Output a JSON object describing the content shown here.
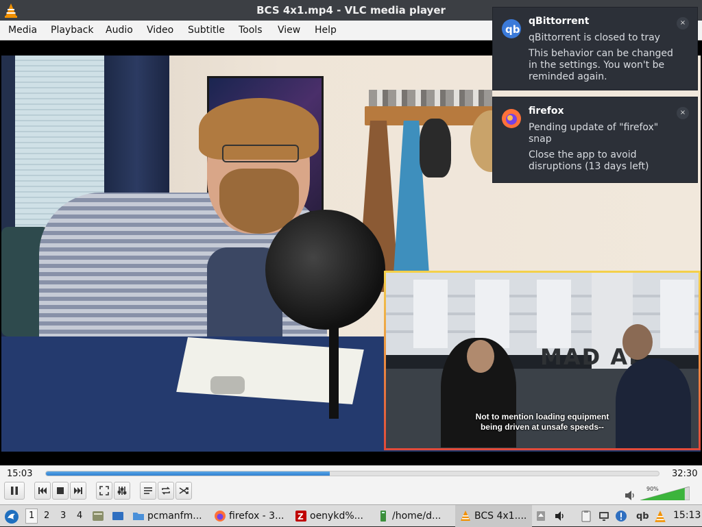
{
  "window": {
    "title": "BCS 4x1.mp4 - VLC media player"
  },
  "menu": [
    "Media",
    "Playback",
    "Audio",
    "Video",
    "Subtitle",
    "Tools",
    "View",
    "Help"
  ],
  "video": {
    "subtitle_line1": "Not to mention loading equipment",
    "subtitle_line2": "being driven at unsafe speeds--",
    "pip_sign": "MAD     AL"
  },
  "player": {
    "elapsed": "15:03",
    "total": "32:30",
    "progress_fraction": 0.463,
    "volume_label": "90%",
    "volume_fraction": 0.9
  },
  "notifications": [
    {
      "app": "qBittorrent",
      "summary": "qBittorrent is closed to tray",
      "body": "This behavior can be changed in the settings. You won't be reminded again.",
      "icon": "qbittorrent-icon",
      "close": "×"
    },
    {
      "app": "firefox",
      "summary": "Pending update of \"firefox\" snap",
      "body": "Close the app to avoid disruptions (13 days left)",
      "icon": "firefox-icon",
      "close": "×"
    }
  ],
  "taskbar": {
    "workspaces": [
      "1",
      "2",
      "3",
      "4"
    ],
    "tasks": [
      {
        "label": "pcmanfm...",
        "icon": "folder-icon"
      },
      {
        "label": "firefox - 3...",
        "icon": "firefox-icon"
      },
      {
        "label": "oenykd%...",
        "icon": "filezilla-icon"
      },
      {
        "label": "/home/d...",
        "icon": "terminal-icon"
      },
      {
        "label": "BCS 4x1....",
        "icon": "vlc-icon"
      }
    ],
    "tray_qb": "qb",
    "clock": "15:13"
  },
  "colors": {
    "accent_blue": "#2e7fd0",
    "notification_bg": "#2c3038",
    "vlc_orange": "#f29100"
  }
}
